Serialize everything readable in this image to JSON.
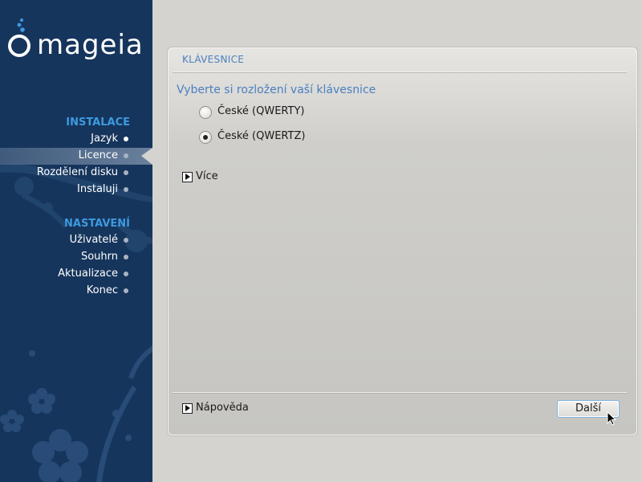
{
  "brand": {
    "logo_text": "mageia",
    "colors": {
      "sidebar": "#16355c",
      "section_title": "#3d9ae0",
      "accent_text": "#4a7fc0"
    }
  },
  "sidebar": {
    "sections": [
      {
        "title": "INSTALACE",
        "items": [
          {
            "label": "Jazyk",
            "state": "done"
          },
          {
            "label": "Licence",
            "state": "active"
          },
          {
            "label": "Rozdělení disku",
            "state": "pending"
          },
          {
            "label": "Instaluji",
            "state": "pending"
          }
        ]
      },
      {
        "title": "NASTAVENÍ",
        "items": [
          {
            "label": "Uživatelé",
            "state": "pending"
          },
          {
            "label": "Souhrn",
            "state": "pending"
          },
          {
            "label": "Aktualizace",
            "state": "pending"
          },
          {
            "label": "Konec",
            "state": "pending"
          }
        ]
      }
    ]
  },
  "panel": {
    "header": "KLÁVESNICE",
    "question": "Vyberte si rozložení vaší klávesnice",
    "options": [
      {
        "label": "České (QWERTY)",
        "checked": false
      },
      {
        "label": "České (QWERTZ)",
        "checked": true
      }
    ],
    "more_label": "Více",
    "help_label": "Nápověda",
    "next_label": "Další"
  },
  "icons": {
    "logo": "mageia-cauldron-icon",
    "expander": "triangle-right-icon",
    "cursor": "mouse-pointer-icon"
  }
}
